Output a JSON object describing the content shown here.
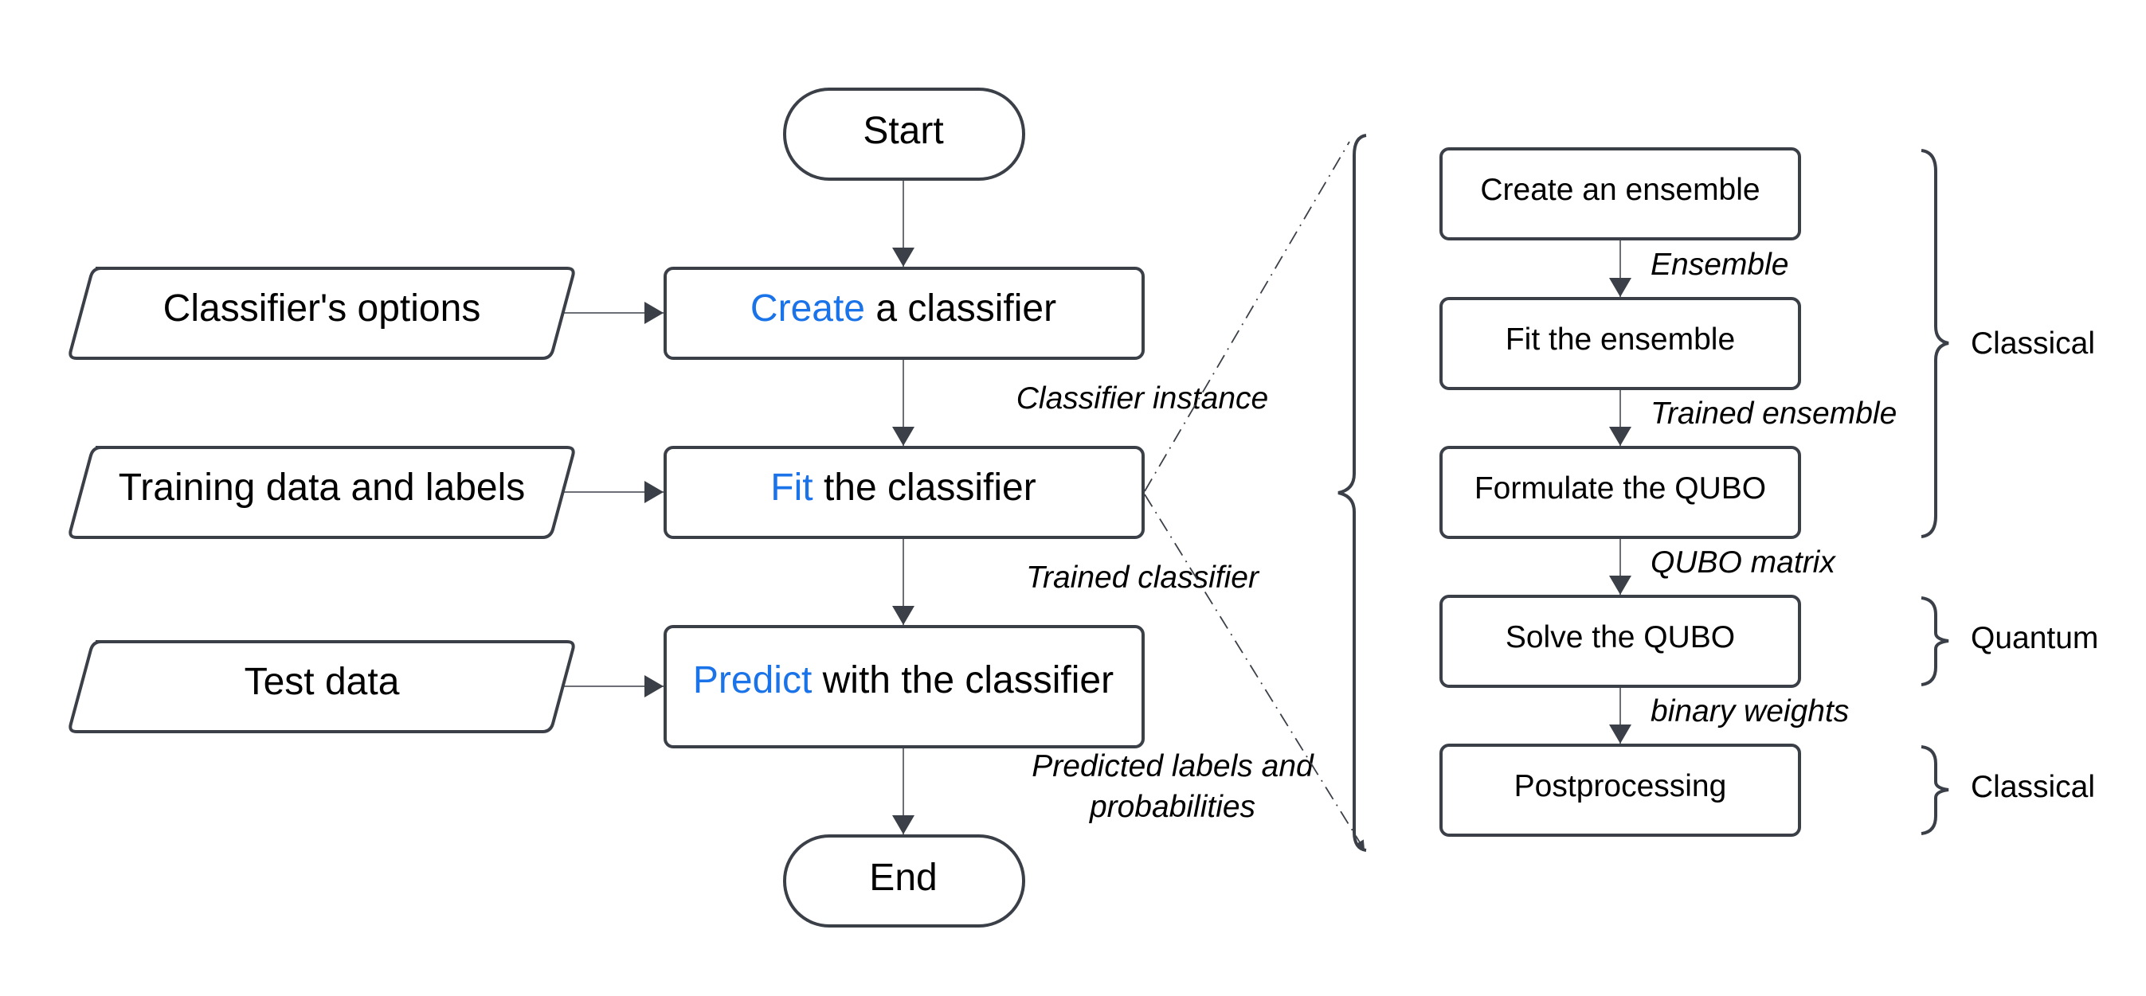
{
  "colors": {
    "accent": "#1a73e8",
    "stroke": "#3b4048",
    "text": "#000000"
  },
  "left_flow": {
    "start": "Start",
    "end": "End",
    "steps": [
      {
        "keyword": "Create",
        "rest": " a classifier",
        "input": "Classifier's options"
      },
      {
        "keyword": "Fit",
        "rest": " the classifier",
        "input": "Training data and labels"
      },
      {
        "keyword": "Predict",
        "rest": " with the classifier",
        "input": "Test data"
      }
    ],
    "edge_labels": {
      "classifier_instance": "Classifier instance",
      "trained_classifier": "Trained classifier",
      "predicted_line1": "Predicted labels and",
      "predicted_line2": "probabilities"
    }
  },
  "right_flow": {
    "steps": [
      "Create an ensemble",
      "Fit the ensemble",
      "Formulate the QUBO",
      "Solve the QUBO",
      "Postprocessing"
    ],
    "edge_labels": [
      "Ensemble",
      "Trained ensemble",
      "QUBO matrix",
      "binary weights"
    ],
    "groups": [
      "Classical",
      "Quantum",
      "Classical"
    ]
  }
}
